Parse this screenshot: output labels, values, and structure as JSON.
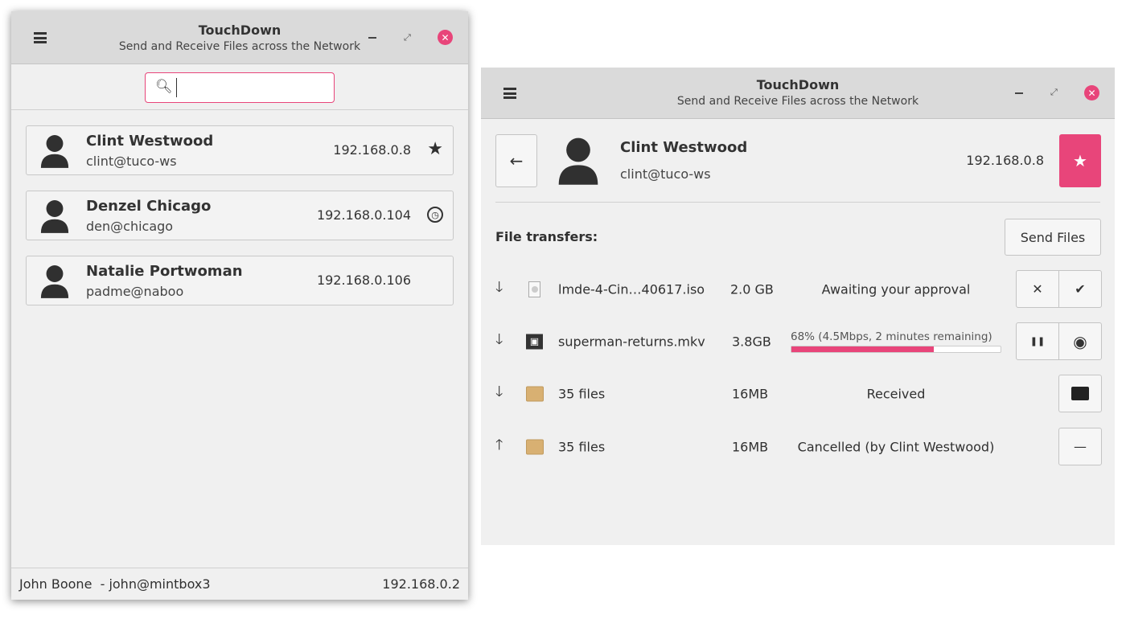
{
  "app": {
    "title": "TouchDown",
    "subtitle": "Send and Receive Files across the Network"
  },
  "left": {
    "search": {
      "value": "",
      "placeholder": ""
    },
    "contacts": [
      {
        "name": "Clint Westwood",
        "email": "clint@tuco-ws",
        "ip": "192.168.0.8",
        "status_icon": "star-icon"
      },
      {
        "name": "Denzel Chicago",
        "email": "den@chicago",
        "ip": "192.168.0.104",
        "status_icon": "clock-icon"
      },
      {
        "name": "Natalie Portwoman",
        "email": "padme@naboo",
        "ip": "192.168.0.106",
        "status_icon": ""
      }
    ],
    "footer": {
      "user": "John Boone  - john@mintbox3",
      "ip": "192.168.0.2"
    }
  },
  "right": {
    "contact": {
      "name": "Clint Westwood",
      "email": "clint@tuco-ws",
      "ip": "192.168.0.8"
    },
    "section_label": "File transfers:",
    "send_files_label": "Send Files",
    "transfers": [
      {
        "direction": "down",
        "file": "lmde-4-Cin…40617.iso",
        "size": "2.0 GB",
        "status": "Awaiting your approval",
        "icon": "disc-image-icon"
      },
      {
        "direction": "down",
        "file": "superman-returns.mkv",
        "size": "3.8GB",
        "status": "68% (4.5Mbps, 2 minutes remaining)",
        "progress": 68,
        "icon": "video-file-icon"
      },
      {
        "direction": "down",
        "file": "35 files",
        "size": "16MB",
        "status": "Received",
        "icon": "package-icon"
      },
      {
        "direction": "up",
        "file": "35 files",
        "size": "16MB",
        "status": "Cancelled (by Clint Westwood)",
        "icon": "package-icon"
      }
    ],
    "glyphs": {
      "down": "🡓",
      "up": "🡑",
      "reject": "✕",
      "accept": "✔",
      "pause": "❚❚",
      "stop": "◉",
      "clear": "—",
      "back": "←",
      "star": "★"
    }
  },
  "colors": {
    "accent": "#e8457a"
  }
}
